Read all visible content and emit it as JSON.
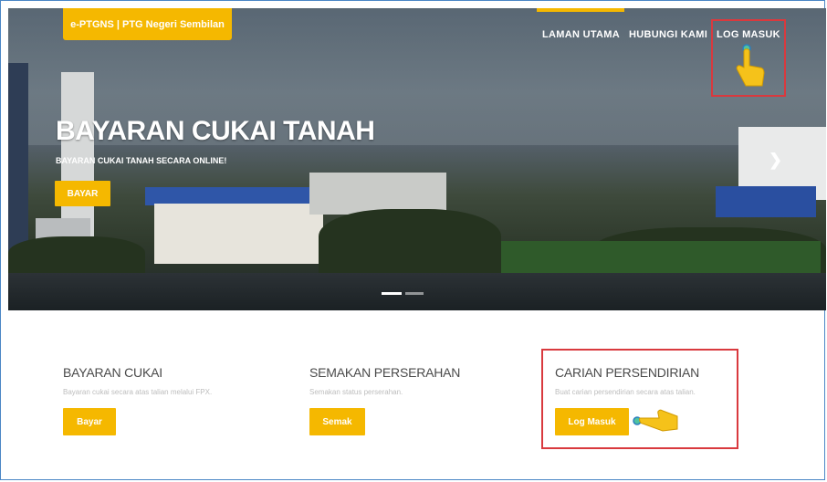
{
  "header": {
    "brand": "e-PTGNS | PTG Negeri Sembilan",
    "nav": [
      {
        "label": "LAMAN UTAMA"
      },
      {
        "label": "HUBUNGI KAMI"
      },
      {
        "label": "LOG MASUK"
      }
    ]
  },
  "hero": {
    "title": "BAYARAN CUKAI TANAH",
    "subtitle": "BAYARAN CUKAI TANAH SECARA ONLINE!",
    "button": "BAYAR",
    "next_icon": "chevron-right-icon"
  },
  "cards": [
    {
      "title": "BAYARAN CUKAI",
      "desc": "Bayaran cukai secara atas talian melalui FPX.",
      "button": "Bayar"
    },
    {
      "title": "SEMAKAN PERSERAHAN",
      "desc": "Semakan status perserahan.",
      "button": "Semak"
    },
    {
      "title": "CARIAN PERSENDIRIAN",
      "desc": "Buat carian persendirian secara atas talian.",
      "button": "Log Masuk"
    }
  ],
  "colors": {
    "accent": "#f5b800",
    "highlight": "#d9393e",
    "frame": "#4a86c5"
  }
}
